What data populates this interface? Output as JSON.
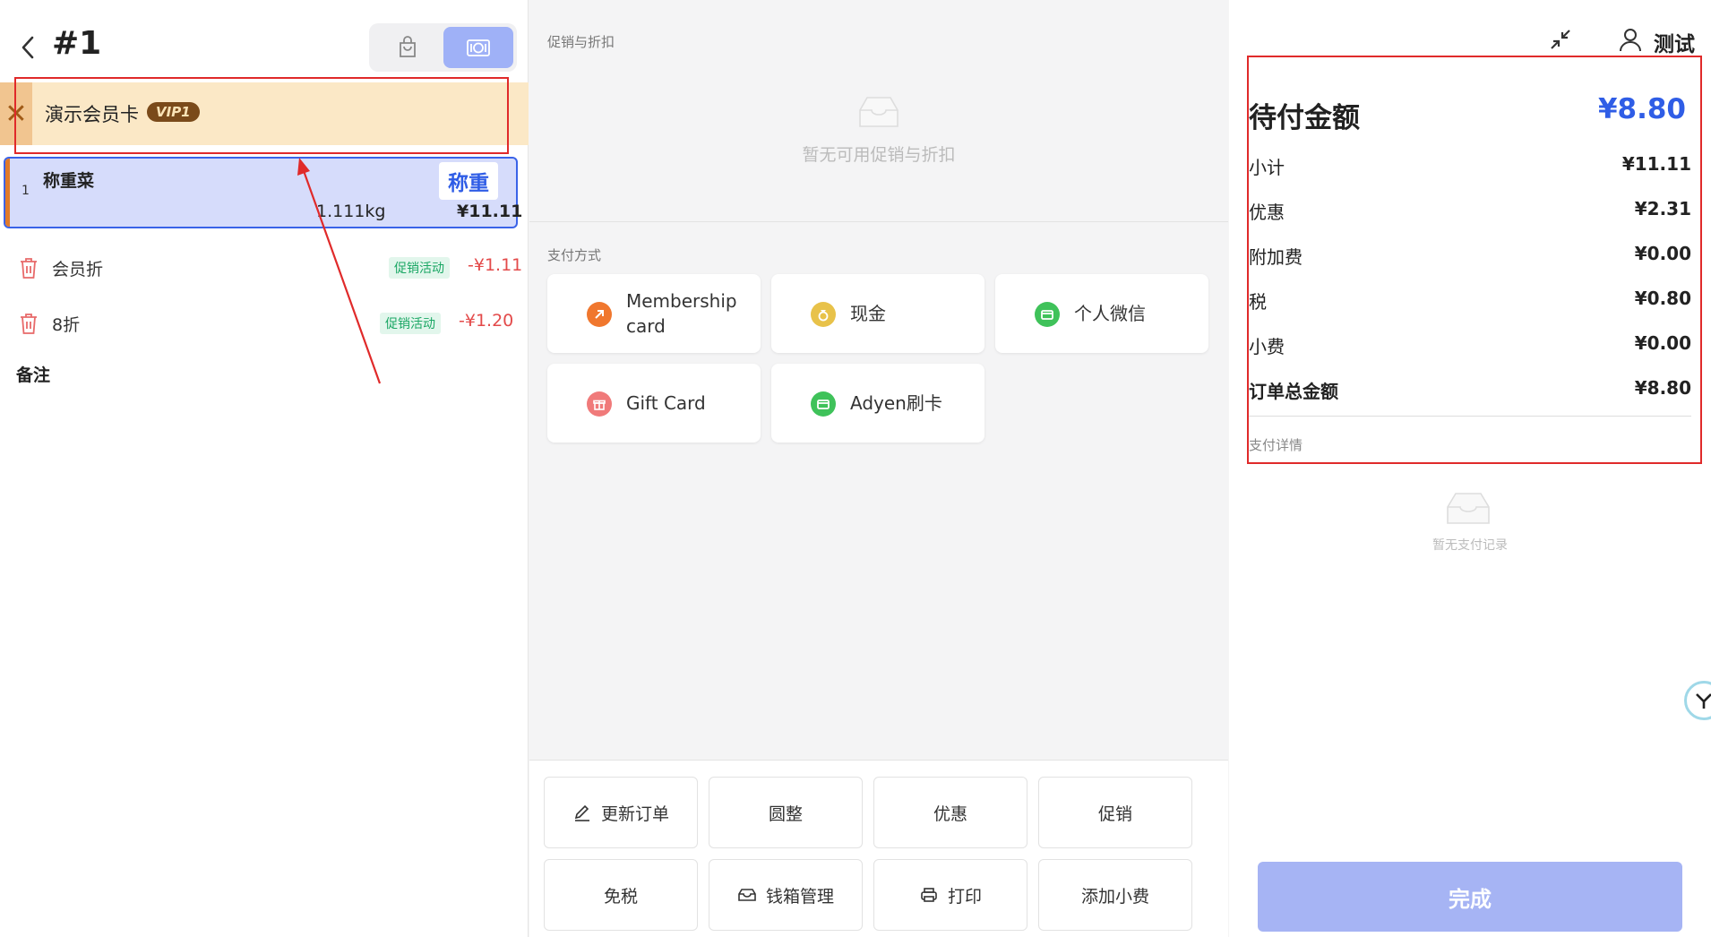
{
  "order": {
    "title": "#1"
  },
  "member": {
    "name": "演示会员卡",
    "level": "VIP1"
  },
  "cart": {
    "items": [
      {
        "index": "1",
        "name": "称重菜",
        "tag": "称重",
        "qty": "1.111kg",
        "price": "¥11.11"
      }
    ],
    "discounts": [
      {
        "name": "会员折",
        "tag": "促销活动",
        "amount": "-¥1.11"
      },
      {
        "name": "8折",
        "tag": "促销活动",
        "amount": "-¥1.20"
      }
    ],
    "notes_label": "备注"
  },
  "promotions": {
    "label": "促销与折扣",
    "empty_text": "暂无可用促销与折扣"
  },
  "payment_methods": {
    "label": "支付方式",
    "items": [
      {
        "label": "Membership card",
        "icon": "membership-card-icon",
        "color": "#f0772e"
      },
      {
        "label": "现金",
        "icon": "cash-bag-icon",
        "color": "#e8c24a"
      },
      {
        "label": "个人微信",
        "icon": "wallet-icon",
        "color": "#3fc25a"
      },
      {
        "label": "Gift Card",
        "icon": "gift-icon",
        "color": "#f07a7a"
      },
      {
        "label": "Adyen刷卡",
        "icon": "wallet-icon",
        "color": "#3fc25a"
      }
    ]
  },
  "actions": [
    {
      "label": "更新订单",
      "icon": "edit-icon"
    },
    {
      "label": "圆整",
      "icon": ""
    },
    {
      "label": "优惠",
      "icon": ""
    },
    {
      "label": "促销",
      "icon": ""
    },
    {
      "label": "免税",
      "icon": ""
    },
    {
      "label": "钱箱管理",
      "icon": "cash-drawer-icon"
    },
    {
      "label": "打印",
      "icon": "printer-icon"
    },
    {
      "label": "添加小费",
      "icon": ""
    }
  ],
  "user": {
    "name": "测试"
  },
  "summary": {
    "due_label": "待付金额",
    "due_amount": "¥8.80",
    "rows": [
      {
        "label": "小计",
        "value": "¥11.11"
      },
      {
        "label": "优惠",
        "value": "¥2.31"
      },
      {
        "label": "附加费",
        "value": "¥0.00"
      },
      {
        "label": "税",
        "value": "¥0.80"
      },
      {
        "label": "小费",
        "value": "¥0.00"
      },
      {
        "label": "订单总金额",
        "value": "¥8.80"
      }
    ],
    "payment_detail_label": "支付详情",
    "empty_records_text": "暂无支付记录"
  },
  "finish_button": "完成",
  "colors": {
    "accent": "#2f5de6",
    "annotation": "#e02a2a",
    "discount": "#e34a4a",
    "promo_tag": "#1aa764"
  }
}
